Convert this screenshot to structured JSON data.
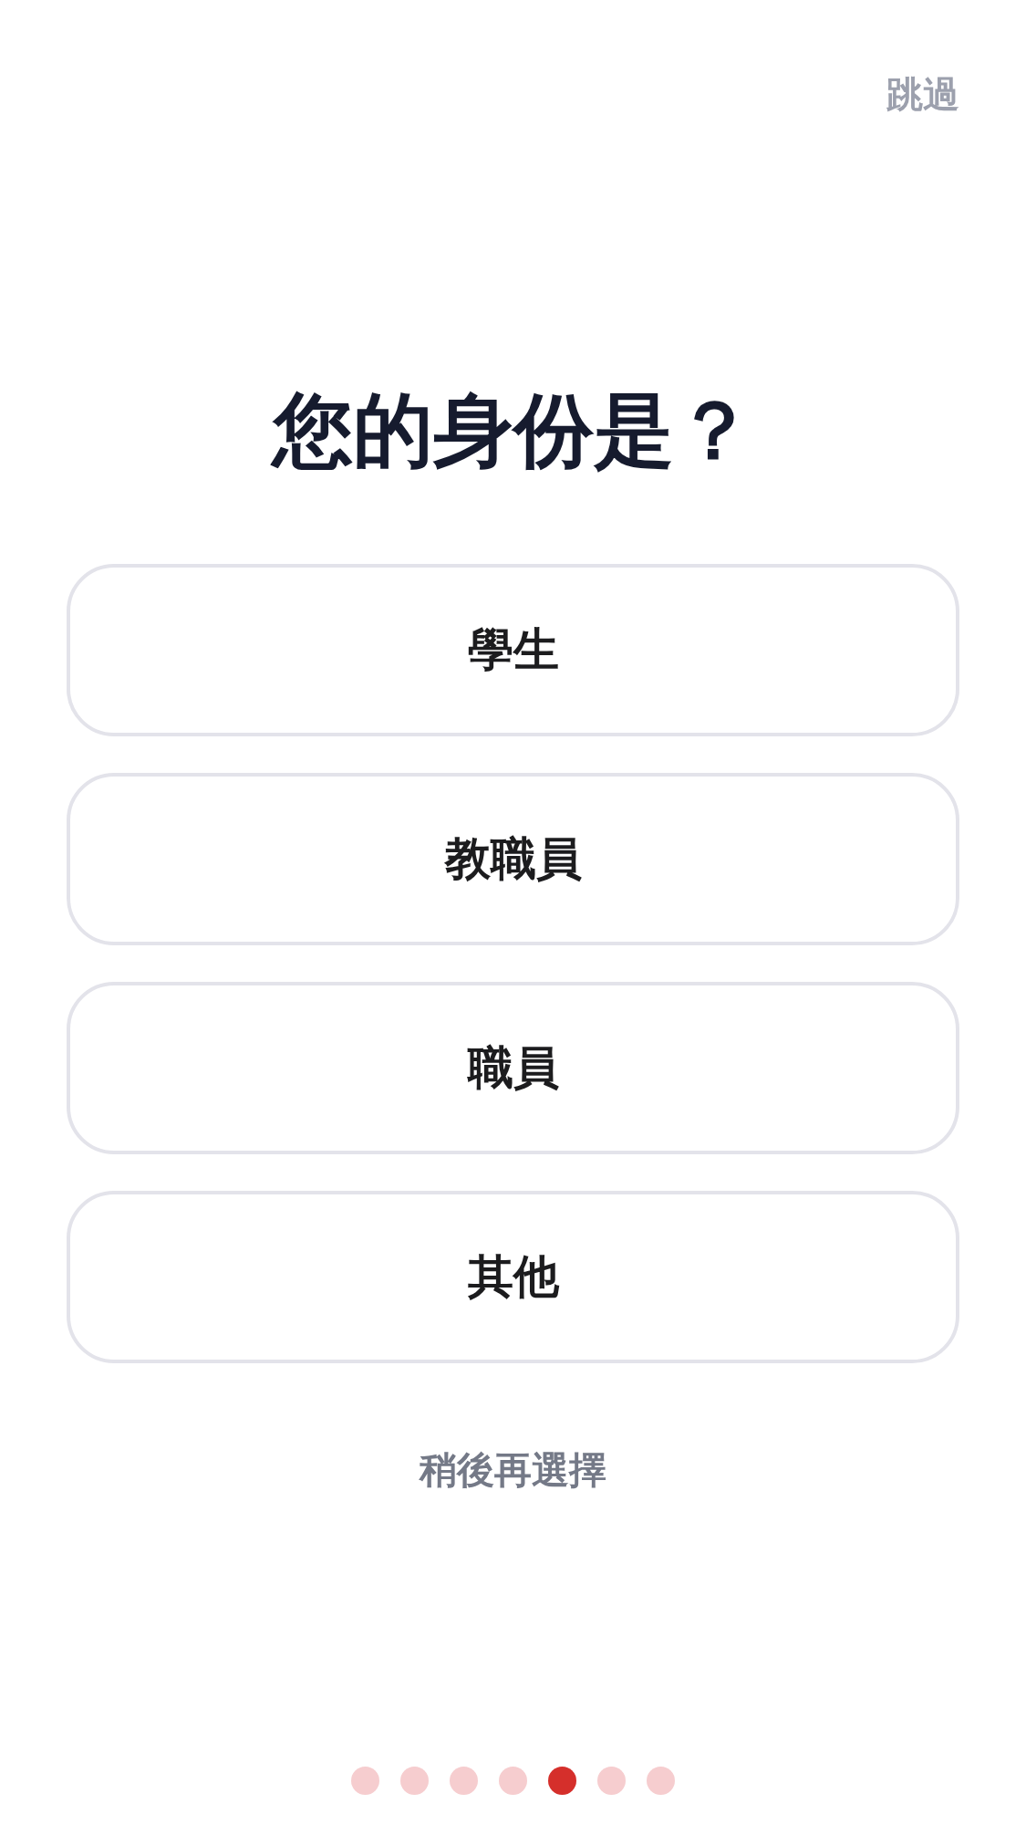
{
  "skip": "跳過",
  "title": "您的身份是？",
  "options": [
    {
      "label": "學生"
    },
    {
      "label": "教職員"
    },
    {
      "label": "職員"
    },
    {
      "label": "其他"
    }
  ],
  "later": "稍後再選擇",
  "pager": [
    {
      "selected": false
    },
    {
      "selected": false
    },
    {
      "selected": false
    },
    {
      "selected": false
    },
    {
      "selected": true
    },
    {
      "selected": false
    },
    {
      "selected": false
    }
  ]
}
